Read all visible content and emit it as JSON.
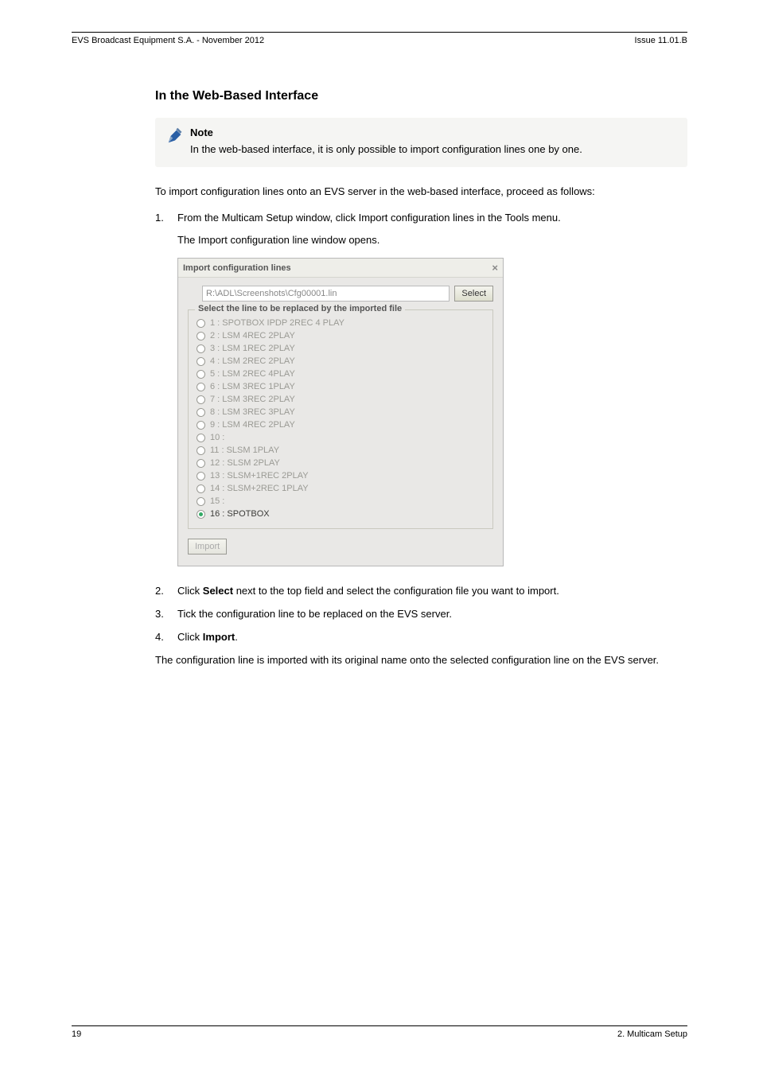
{
  "header": {
    "left": "EVS Broadcast Equipment S.A.  - November 2012",
    "right": "Issue 11.01.B"
  },
  "section": {
    "heading": "In the Web-Based Interface"
  },
  "note": {
    "title": "Note",
    "text": "In the web-based interface, it is only possible to import configuration lines one by one."
  },
  "intro": "To import configuration lines onto an EVS server in the web-based interface, proceed as follows:",
  "steps": {
    "s1": {
      "num": "1.",
      "text": "From the Multicam Setup window, click Import configuration lines in the Tools menu."
    },
    "s1_sub": "The Import configuration line window opens.",
    "s2": {
      "num": "2.",
      "before": "Click ",
      "bold": "Select",
      "after": " next to the top field and select the configuration file you want to import."
    },
    "s3": {
      "num": "3.",
      "text": "Tick the configuration line to be replaced on the EVS server."
    },
    "s4": {
      "num": "4.",
      "before": "Click ",
      "bold": "Import",
      "after": "."
    }
  },
  "closing": "The configuration line is imported with its original name onto the selected configuration line on the EVS server.",
  "dialog": {
    "title": "Import configuration lines",
    "close": "×",
    "path": "R:\\ADL\\Screenshots\\Cfg00001.lin",
    "select_btn": "Select",
    "legend": "Select the line to be replaced by the imported file",
    "items": [
      "1 : SPOTBOX IPDP 2REC 4 PLAY",
      "2 : LSM 4REC 2PLAY",
      "3 : LSM 1REC 2PLAY",
      "4 : LSM 2REC 2PLAY",
      "5 : LSM 2REC 4PLAY",
      "6 : LSM 3REC 1PLAY",
      "7 : LSM 3REC 2PLAY",
      "8 : LSM 3REC 3PLAY",
      "9 : LSM 4REC 2PLAY",
      "10 :",
      "11 : SLSM 1PLAY",
      "12 : SLSM 2PLAY",
      "13 : SLSM+1REC 2PLAY",
      "14 : SLSM+2REC 1PLAY",
      "15 :",
      "16 : SPOTBOX"
    ],
    "selected_index": 15,
    "import_btn": "Import"
  },
  "footer": {
    "left": "19",
    "right": "2. Multicam Setup"
  }
}
